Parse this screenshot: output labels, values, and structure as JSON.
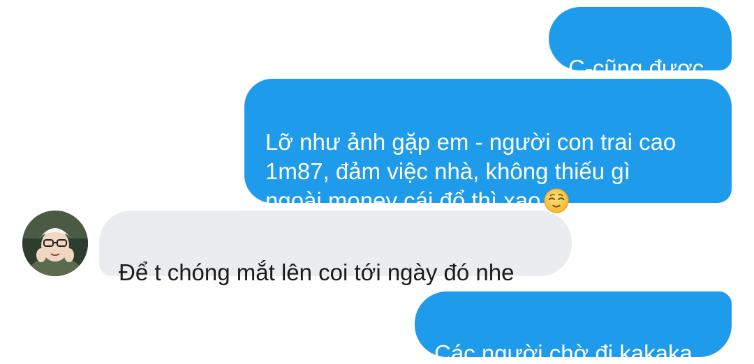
{
  "colors": {
    "outgoing_bubble": "#1e9bea",
    "incoming_bubble": "#eaecef",
    "background": "#ffffff"
  },
  "messages": [
    {
      "direction": "outgoing",
      "text": "C-cũng được"
    },
    {
      "direction": "outgoing",
      "text": "Lỡ như ảnh gặp em - người con trai cao\n1m87, đảm việc nhà, không thiếu gì\nngoài money cái đổ thì xao",
      "emoji": "relieved-face"
    },
    {
      "direction": "incoming",
      "text": "Để t chóng mắt lên coi tới ngày đó nhe",
      "avatar": "user-avatar"
    },
    {
      "direction": "outgoing",
      "text": "Các người chờ đi kakaka"
    }
  ]
}
